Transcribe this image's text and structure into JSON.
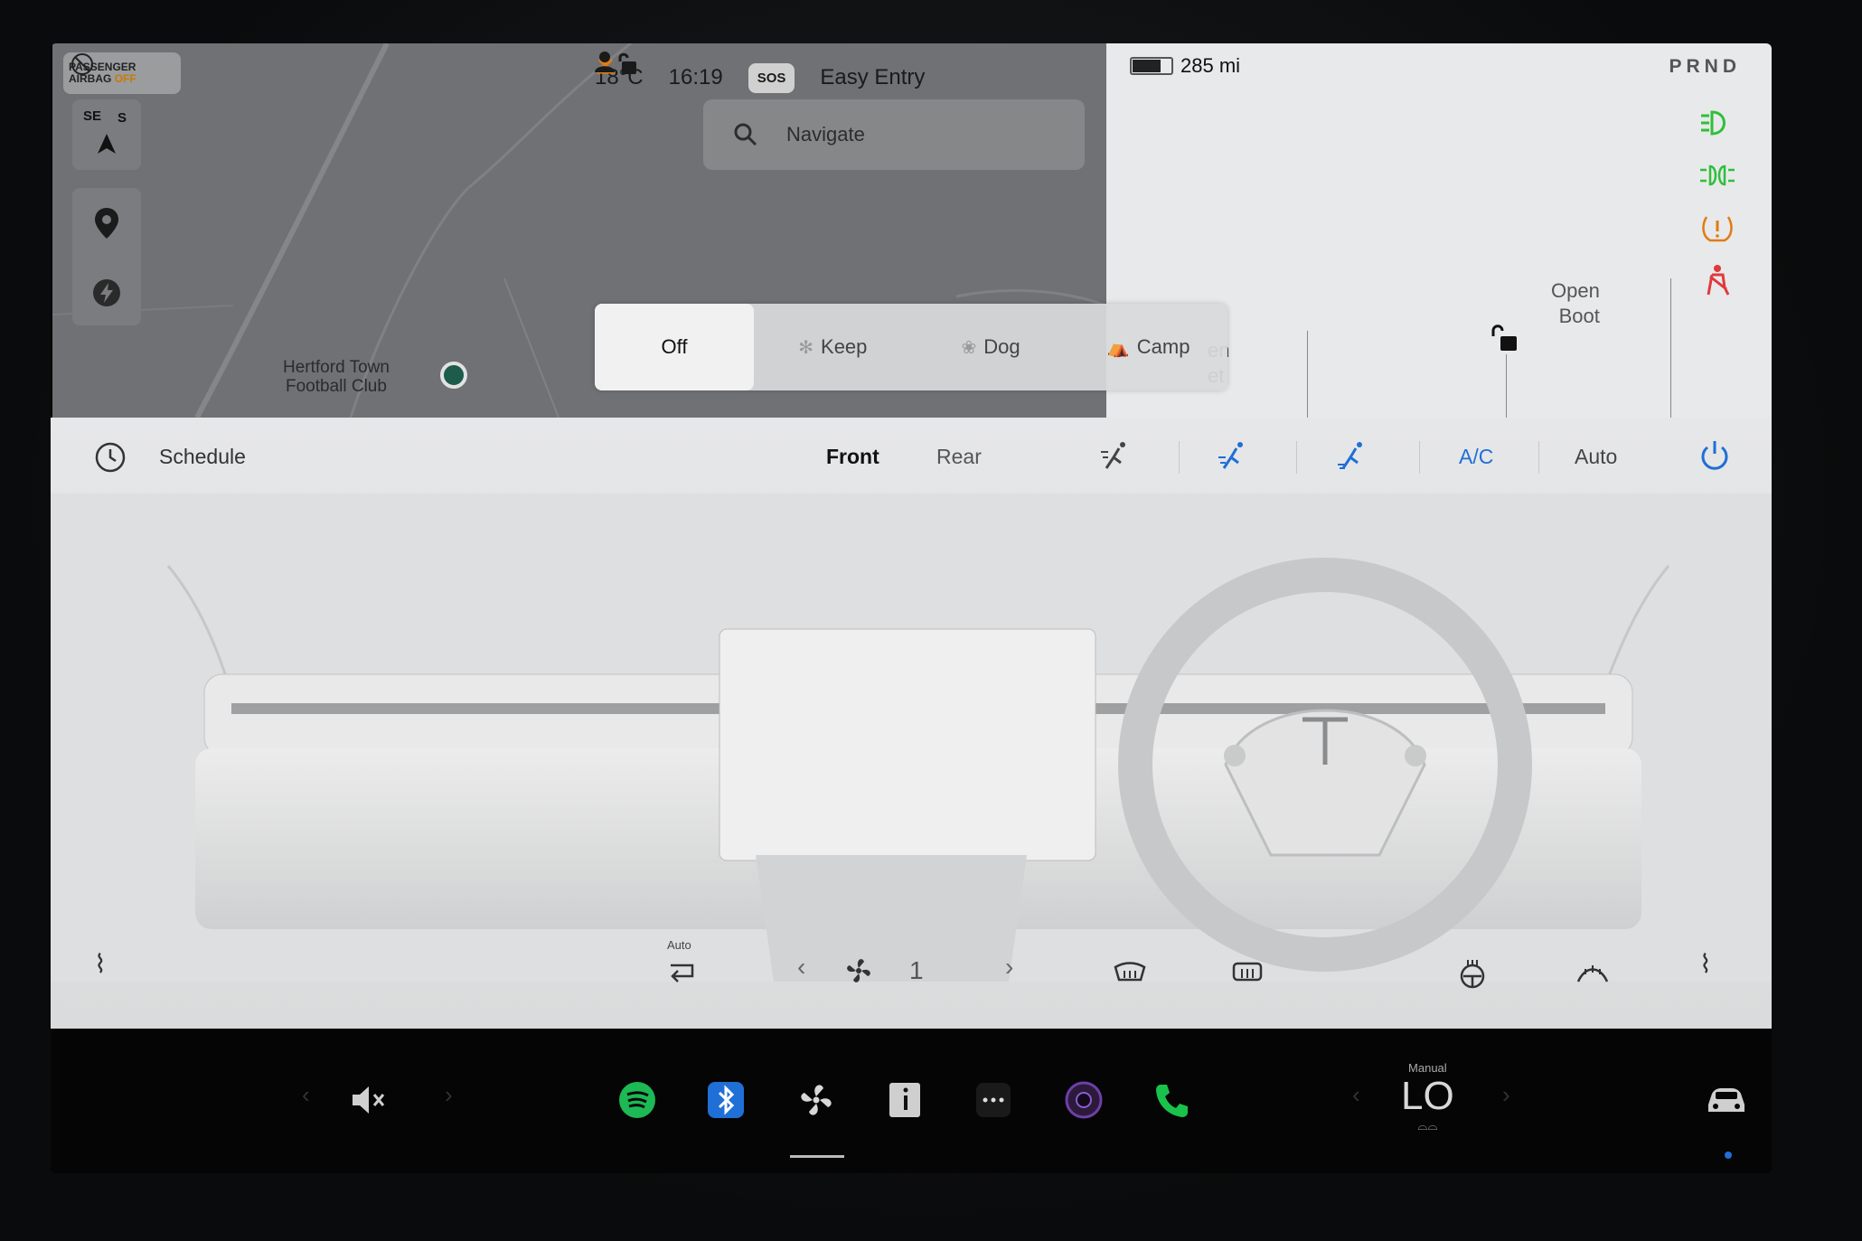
{
  "status": {
    "airbag_label_1": "PASSENGER",
    "airbag_label_2": "AIRBAG",
    "airbag_state": "OFF",
    "temperature": "18°C",
    "time": "16:19",
    "sos": "SOS",
    "profile": "Easy Entry",
    "range": "285 mi",
    "gear": "PRND"
  },
  "map": {
    "compass_1": "SE",
    "compass_2": "S",
    "search_placeholder": "Navigate",
    "poi_line1": "Hertford Town",
    "poi_line2": "Football Club"
  },
  "car": {
    "open_boot_1": "Open",
    "open_boot_2": "Boot",
    "open_frunk_1": "en",
    "open_frunk_2": "et"
  },
  "modes": {
    "off": "Off",
    "keep": "Keep",
    "dog": "Dog",
    "camp": "Camp",
    "active": "Off"
  },
  "climate": {
    "schedule": "Schedule",
    "front": "Front",
    "rear": "Rear",
    "ac": "A/C",
    "auto": "Auto",
    "recirc_label": "Auto",
    "fan_speed": "1"
  },
  "dock": {
    "lo_mode": "Manual",
    "lo_value": "LO"
  },
  "colors": {
    "accent_blue": "#1f6fd6",
    "telltale_green": "#2fbf3a",
    "telltale_orange": "#e07b16",
    "telltale_red": "#e0393d",
    "spotify": "#1db954",
    "phone": "#19c24a"
  }
}
